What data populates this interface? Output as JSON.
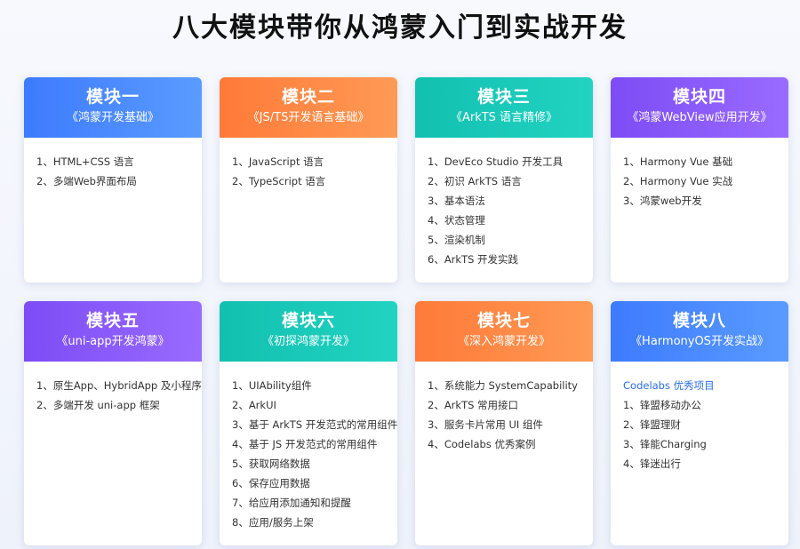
{
  "page": {
    "title": "八大模块带你从鸿蒙入门到实战开发"
  },
  "colors": {
    "blue": "#3d7bff",
    "orange": "#ff7a38",
    "teal": "#12c0b0",
    "purple": "#7d4cf5",
    "highlight": "#2a6fe0"
  },
  "modules": [
    {
      "title": "模块一",
      "subtitle": "《鸿蒙开发基础》",
      "items": [
        "1、HTML+CSS 语言",
        "2、多端Web界面布局"
      ]
    },
    {
      "title": "模块二",
      "subtitle": "《JS/TS开发语言基础》",
      "items": [
        "1、JavaScript 语言",
        "2、TypeScript 语言"
      ]
    },
    {
      "title": "模块三",
      "subtitle": "《ArkTS 语言精修》",
      "items": [
        "1、DevEco Studio 开发工具",
        "2、初识 ArkTS 语言",
        "3、基本语法",
        "4、状态管理",
        "5、渲染机制",
        "6、ArkTS 开发实践"
      ]
    },
    {
      "title": "模块四",
      "subtitle": "《鸿蒙WebView应用开发》",
      "items": [
        "1、Harmony Vue 基础",
        "2、Harmony Vue 实战",
        "3、鸿蒙web开发"
      ]
    },
    {
      "title": "模块五",
      "subtitle": "《uni-app开发鸿蒙》",
      "items": [
        "1、原生App、HybridApp 及小程序",
        "2、多端开发 uni-app 框架"
      ]
    },
    {
      "title": "模块六",
      "subtitle": "《初探鸿蒙开发》",
      "items": [
        "1、UIAbility组件",
        "2、ArkUI",
        "3、基于 ArkTS 开发范式的常用组件",
        "4、基于 JS 开发范式的常用组件",
        "5、获取网络数据",
        "6、保存应用数据",
        "7、给应用添加通知和提醒",
        "8、应用/服务上架"
      ]
    },
    {
      "title": "模块七",
      "subtitle": "《深入鸿蒙开发》",
      "items": [
        "1、系统能力 SystemCapability",
        "2、ArkTS 常用接口",
        "3、服务卡片常用 UI 组件",
        "4、Codelabs 优秀案例"
      ]
    },
    {
      "title": "模块八",
      "subtitle": "《HarmonyOS开发实战》",
      "highlight": "Codelabs 优秀项目",
      "items": [
        "1、锋盟移动办公",
        "2、锋盟理财",
        "3、锋能Charging",
        "4、锋迷出行"
      ]
    }
  ]
}
